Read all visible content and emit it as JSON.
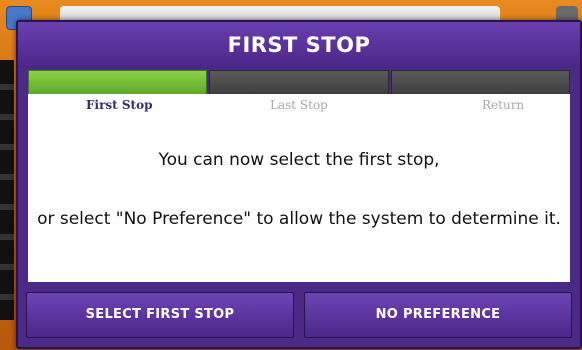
{
  "dialog": {
    "title": "FIRST STOP",
    "steps": [
      {
        "label": "First Stop",
        "active": true
      },
      {
        "label": "Last Stop",
        "active": false
      },
      {
        "label": "Return",
        "active": false
      }
    ],
    "message_line1": "You can now select the first stop,",
    "message_line2": "or select \"No Preference\" to allow the system to determine it.",
    "buttons": {
      "select_first_stop": "SELECT FIRST STOP",
      "no_preference": "NO PREFERENCE"
    }
  },
  "colors": {
    "accent_purple": "#4b2a86",
    "progress_active": "#7cc23e",
    "progress_inactive": "#4a4a4a",
    "background_orange": "#c86a10"
  }
}
